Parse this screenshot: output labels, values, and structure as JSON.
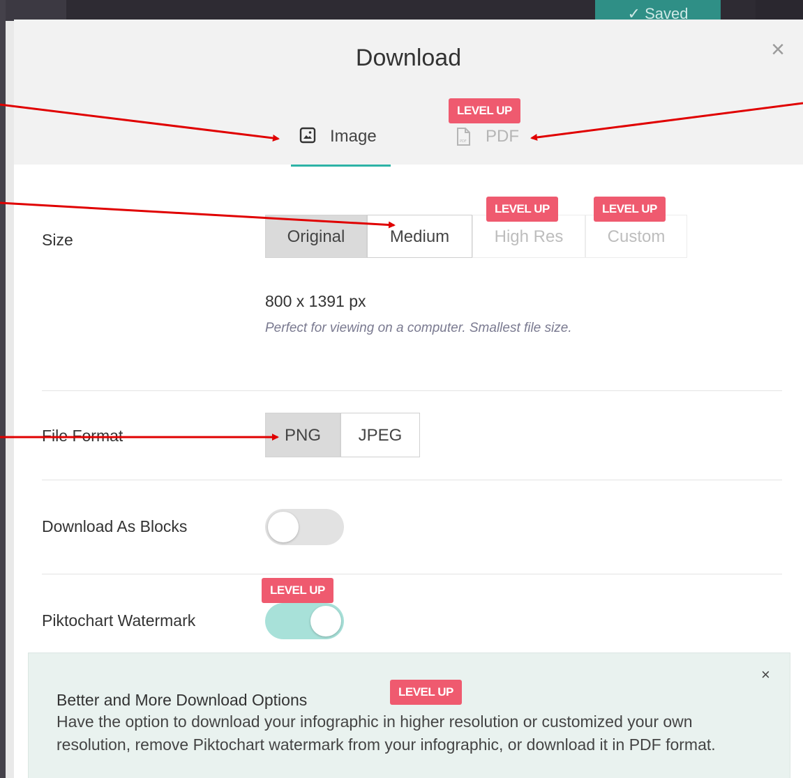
{
  "app": {
    "saved_label": "✓ Saved"
  },
  "modal": {
    "title": "Download",
    "close_glyph": "×"
  },
  "tabs": [
    {
      "label": "Image",
      "icon": "image-icon",
      "active": true
    },
    {
      "label": "PDF",
      "icon": "pdf-file-icon",
      "active": false,
      "badge": "LEVEL UP"
    }
  ],
  "size": {
    "label": "Size",
    "options": [
      {
        "label": "Original",
        "selected": true
      },
      {
        "label": "Medium",
        "selected": false
      },
      {
        "label": "High Res",
        "selected": false,
        "badge": "LEVEL UP"
      },
      {
        "label": "Custom",
        "selected": false,
        "badge": "LEVEL UP"
      }
    ],
    "dimensions": "800 x 1391 px",
    "description": "Perfect for viewing on a computer. Smallest file size."
  },
  "file_format": {
    "label": "File Format",
    "options": [
      {
        "label": "PNG",
        "selected": true
      },
      {
        "label": "JPEG",
        "selected": false
      }
    ]
  },
  "download_as_blocks": {
    "label": "Download As Blocks",
    "on": false
  },
  "watermark": {
    "label": "Piktochart Watermark",
    "on": true,
    "badge": "LEVEL UP"
  },
  "promo": {
    "title": "Better and More Download Options",
    "badge": "LEVEL UP",
    "close_glyph": "×",
    "text": "Have the option to download your infographic in higher resolution or customized your own resolution, remove Piktochart watermark from your infographic, or download it in PDF format."
  },
  "colors": {
    "accent": "#2db3a6",
    "badge": "#ef5a6f",
    "toggle_on": "#a8e1d9",
    "annotation_arrow": "#e00000"
  }
}
